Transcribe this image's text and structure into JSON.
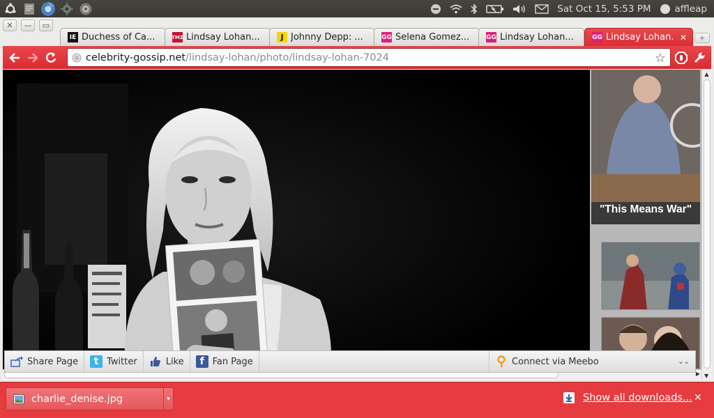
{
  "panel": {
    "clock": "Sat Oct 15,  5:53 PM",
    "user": "affleap",
    "icons": [
      "ubuntu-logo-icon",
      "text-editor-icon",
      "chromium-icon",
      "system-settings-icon",
      "software-center-icon"
    ],
    "indicators": [
      "messaging-indicator-icon",
      "wifi-icon",
      "bluetooth-icon",
      "battery-icon",
      "volume-icon",
      "mail-icon"
    ]
  },
  "tabs": [
    {
      "title": "Duchess of Ca...",
      "favicon": "IE",
      "favicon_bg": "#111111",
      "favicon_color": "#ffffff"
    },
    {
      "title": "Lindsay Lohan...",
      "favicon": "TMZ",
      "favicon_bg": "#c8102e",
      "favicon_color": "#ffffff"
    },
    {
      "title": "Johnny Depp: ...",
      "favicon": "J",
      "favicon_bg": "#f5d500",
      "favicon_color": "#111111"
    },
    {
      "title": "Selena Gomez...",
      "favicon": "GG",
      "favicon_bg": "#e01e7a",
      "favicon_color": "#ffffff"
    },
    {
      "title": "Lindsay Lohan...",
      "favicon": "GG",
      "favicon_bg": "#e01e7a",
      "favicon_color": "#ffffff"
    },
    {
      "title": "Lindsay Lohan...",
      "favicon": "GG",
      "favicon_bg": "#e01e7a",
      "favicon_color": "#ffffff",
      "active": true
    }
  ],
  "toolbar": {
    "url_host": "celebrity-gossip.net",
    "url_path": "/lindsay-lohan/photo/lindsay-lohan-7024"
  },
  "sidebar": {
    "caption": "\"This Means War\""
  },
  "sharebar": {
    "share_label": "Share Page",
    "twitter_label": "Twitter",
    "like_label": "Like",
    "fanpage_label": "Fan Page",
    "meebo_label": "Connect via Meebo"
  },
  "downloads": {
    "filename": "charlie_denise.jpg",
    "show_all_label": "Show all downloads..."
  },
  "colors": {
    "accent": "#e03a40",
    "panel": "#3c3b37"
  }
}
